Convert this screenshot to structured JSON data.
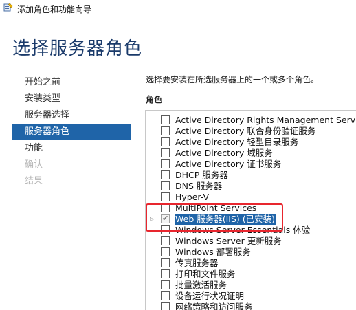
{
  "window": {
    "title": "添加角色和功能向导",
    "icon": "wizard-icon"
  },
  "page": {
    "title": "选择服务器角色"
  },
  "nav": {
    "items": [
      {
        "label": "开始之前",
        "state": "normal"
      },
      {
        "label": "安装类型",
        "state": "normal"
      },
      {
        "label": "服务器选择",
        "state": "normal"
      },
      {
        "label": "服务器角色",
        "state": "active"
      },
      {
        "label": "功能",
        "state": "normal"
      },
      {
        "label": "确认",
        "state": "disabled"
      },
      {
        "label": "结果",
        "state": "disabled"
      }
    ]
  },
  "main": {
    "instruction": "选择要安装在所选服务器上的一个或多个角色。",
    "roles_header": "角色"
  },
  "roles": [
    {
      "label": "Active Directory Rights Management Services",
      "checked": false
    },
    {
      "label": "Active Directory 联合身份验证服务",
      "checked": false
    },
    {
      "label": "Active Directory 轻型目录服务",
      "checked": false
    },
    {
      "label": "Active Directory 域服务",
      "checked": false
    },
    {
      "label": "Active Directory 证书服务",
      "checked": false
    },
    {
      "label": "DHCP 服务器",
      "checked": false
    },
    {
      "label": "DNS 服务器",
      "checked": false
    },
    {
      "label": "Hyper-V",
      "checked": false
    },
    {
      "label": "MultiPoint Services",
      "checked": false
    },
    {
      "label": "Web 服务器(IIS) (已安装)",
      "checked": true,
      "selected": true,
      "expandable": true
    },
    {
      "label": "Windows Server Essentials 体验",
      "checked": false
    },
    {
      "label": "Windows Server 更新服务",
      "checked": false
    },
    {
      "label": "Windows 部署服务",
      "checked": false
    },
    {
      "label": "传真服务器",
      "checked": false
    },
    {
      "label": "打印和文件服务",
      "checked": false
    },
    {
      "label": "批量激活服务",
      "checked": false
    },
    {
      "label": "设备运行状况证明",
      "checked": false
    },
    {
      "label": "网络策略和访问服务",
      "checked": false
    }
  ],
  "colors": {
    "accent": "#1f64a8",
    "title": "#1a3a6a",
    "highlight": "#e8262e"
  }
}
